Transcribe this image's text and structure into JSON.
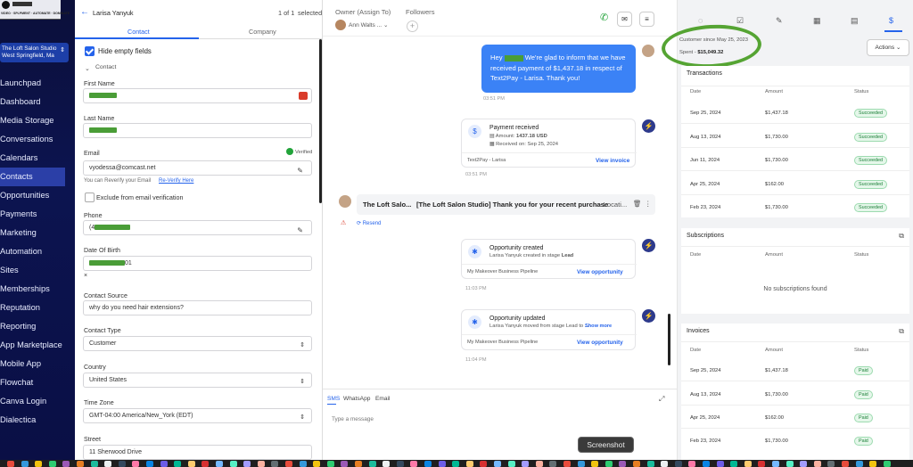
{
  "sidebar": {
    "logo_text": "VIDEO · SPLPMENT · AUTOMATE · DOMINATE",
    "location_name": "The Loft Salon Studio",
    "location_city": "West Springfield, Ma",
    "items": [
      {
        "label": "Launchpad"
      },
      {
        "label": "Dashboard"
      },
      {
        "label": "Media Storage"
      },
      {
        "label": "Conversations"
      },
      {
        "label": "Calendars"
      },
      {
        "label": "Contacts"
      },
      {
        "label": "Opportunities"
      },
      {
        "label": "Payments"
      },
      {
        "label": "Marketing"
      },
      {
        "label": "Automation"
      },
      {
        "label": "Sites"
      },
      {
        "label": "Memberships"
      },
      {
        "label": "Reputation"
      },
      {
        "label": "Reporting"
      },
      {
        "label": "App Marketplace"
      },
      {
        "label": "Mobile App"
      },
      {
        "label": "Flowchat"
      },
      {
        "label": "Canva Login"
      },
      {
        "label": "Dialectica"
      }
    ],
    "active_item": "Contacts"
  },
  "contact": {
    "name": "Larisa Yanyuk",
    "pagination": "1 of 1",
    "selected": "selected",
    "tabs": [
      "Contact",
      "Company"
    ],
    "hide_empty": "Hide empty fields",
    "section": "Contact",
    "first_name_label": "First Name",
    "last_name_label": "Last Name",
    "email_label": "Email",
    "email_verified": "Verified",
    "email_value": "vyodessa@comcast.net",
    "reverify_text": "You can Reverify your Email",
    "reverify_link": "Re-Verify Here",
    "exclude_label": "Exclude from email verification",
    "phone_label": "Phone",
    "phone_prefix": "(4",
    "dob_label": "Date Of Birth",
    "dob_suffix": "01",
    "dob_clear": "×",
    "source_label": "Contact Source",
    "source_value": "why do you need hair extensions?",
    "type_label": "Contact Type",
    "type_value": "Customer",
    "country_label": "Country",
    "country_value": "United States",
    "tz_label": "Time Zone",
    "tz_value": "GMT-04:00 America/New_York (EDT)",
    "street_label": "Street",
    "street_value": "11 Sherwood Drive"
  },
  "conversation": {
    "owner_label": "Owner (Assign To)",
    "owner_value": "Ann Walts ...",
    "followers_label": "Followers",
    "message_prefix": "Hey",
    "message_rest": "We're glad to inform that we have received payment of $1,437.18 in respect of Text2Pay - Larisa. Thank you!",
    "message_time": "03:51 PM",
    "payment": {
      "title": "Payment received",
      "amount_label": "Amount:",
      "amount": "1437.18 USD",
      "received": "Received on: Sep 25, 2024",
      "footer": "Text2Pay - Larisa",
      "link": "View invoice",
      "time": "03:51 PM"
    },
    "email": {
      "from": "The Loft Salo...",
      "subject": "[The Loft Salon Studio] Thank you for your recent purchase",
      "preview": "Locati...",
      "resend": "Resend"
    },
    "opp_created": {
      "title": "Opportunity created",
      "desc_prefix": "Larisa Yanyuk created in stage",
      "stage": "Lead",
      "pipeline": "My Makeover Business Pipeline",
      "link": "View opportunity",
      "time": "11:03 PM"
    },
    "opp_updated": {
      "title": "Opportunity updated",
      "desc": "Larisa Yanyuk moved from stage Lead to ...",
      "more": "Show more",
      "pipeline": "My Makeover Business Pipeline",
      "link": "View opportunity",
      "time": "11:04 PM"
    },
    "compose_tabs": [
      "SMS",
      "WhatsApp",
      "Email"
    ],
    "compose_placeholder": "Type a message"
  },
  "right": {
    "customer_since": "Customer since May 25, 2023",
    "spent_label": "Spent -",
    "spent_value": "$15,049.32",
    "actions_label": "Actions",
    "transactions": {
      "title": "Transactions",
      "columns": [
        "Date",
        "Amount",
        "Status"
      ],
      "rows": [
        {
          "date": "Sep 25, 2024",
          "amount": "$1,437.18",
          "status": "Succeeded"
        },
        {
          "date": "Aug 13, 2024",
          "amount": "$1,730.00",
          "status": "Succeeded"
        },
        {
          "date": "Jun 11, 2024",
          "amount": "$1,730.00",
          "status": "Succeeded"
        },
        {
          "date": "Apr 25, 2024",
          "amount": "$162.00",
          "status": "Succeeded"
        },
        {
          "date": "Feb 23, 2024",
          "amount": "$1,730.00",
          "status": "Succeeded"
        }
      ]
    },
    "subscriptions": {
      "title": "Subscriptions",
      "columns": [
        "Date",
        "Amount",
        "Status"
      ],
      "empty": "No subscriptions found"
    },
    "invoices": {
      "title": "Invoices",
      "columns": [
        "Date",
        "Amount",
        "Status"
      ],
      "rows": [
        {
          "date": "Sep 25, 2024",
          "amount": "$1,437.18",
          "status": "Paid"
        },
        {
          "date": "Aug 13, 2024",
          "amount": "$1,730.00",
          "status": "Paid"
        },
        {
          "date": "Apr 25, 2024",
          "amount": "$162.00",
          "status": "Paid"
        },
        {
          "date": "Feb 23, 2024",
          "amount": "$1,730.00",
          "status": "Paid"
        }
      ]
    }
  },
  "tooltip": "Screenshot",
  "colors": {
    "accent": "#2563eb",
    "annotation": "#55a433",
    "sidebar": "#0b0f3a"
  }
}
